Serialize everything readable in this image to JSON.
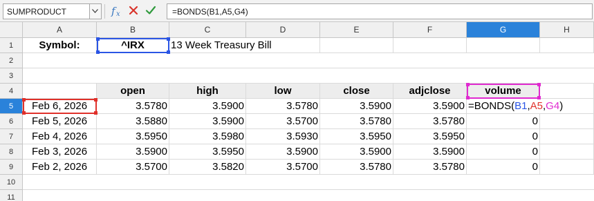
{
  "formula_bar": {
    "name_box": "SUMPRODUCT",
    "formula": "=BONDS(B1,A5,G4)"
  },
  "columns": [
    "A",
    "B",
    "C",
    "D",
    "E",
    "F",
    "G",
    "H"
  ],
  "active_column": "G",
  "rows": [
    "1",
    "2",
    "3",
    "4",
    "5",
    "6",
    "7",
    "8",
    "9",
    "10",
    "11"
  ],
  "active_row": "5",
  "sheet": {
    "symbol_label": "Symbol:",
    "symbol_value": "^IRX",
    "description": "13 Week Treasury Bill",
    "headers": [
      "open",
      "high",
      "low",
      "close",
      "adjclose",
      "volume"
    ],
    "data": [
      {
        "date": "Feb 6, 2026",
        "open": "3.5780",
        "high": "3.5900",
        "low": "3.5780",
        "close": "3.5900",
        "adjclose": "3.5900",
        "volume": ""
      },
      {
        "date": "Feb 5, 2026",
        "open": "3.5880",
        "high": "3.5900",
        "low": "3.5700",
        "close": "3.5780",
        "adjclose": "3.5780",
        "volume": "0"
      },
      {
        "date": "Feb 4, 2026",
        "open": "3.5950",
        "high": "3.5980",
        "low": "3.5930",
        "close": "3.5950",
        "adjclose": "3.5950",
        "volume": "0"
      },
      {
        "date": "Feb 3, 2026",
        "open": "3.5900",
        "high": "3.5950",
        "low": "3.5900",
        "close": "3.5900",
        "adjclose": "3.5900",
        "volume": "0"
      },
      {
        "date": "Feb 2, 2026",
        "open": "3.5700",
        "high": "3.5820",
        "low": "3.5700",
        "close": "3.5780",
        "adjclose": "3.5780",
        "volume": "0"
      }
    ],
    "editing": {
      "prefix": "=BONDS(",
      "ref1": "B1",
      "comma1": ",",
      "ref2": "A5",
      "comma2": ",",
      "ref3": "G4",
      "suffix": ")"
    }
  },
  "colors": {
    "accent": "#2a82da",
    "ref_blue": "#2a55e5",
    "ref_red": "#e0302a",
    "ref_magenta": "#e02ad0",
    "header_shade": "#ededed"
  },
  "icons": [
    "chevron-down-icon",
    "function-wizard-icon",
    "cancel-icon",
    "accept-icon"
  ]
}
